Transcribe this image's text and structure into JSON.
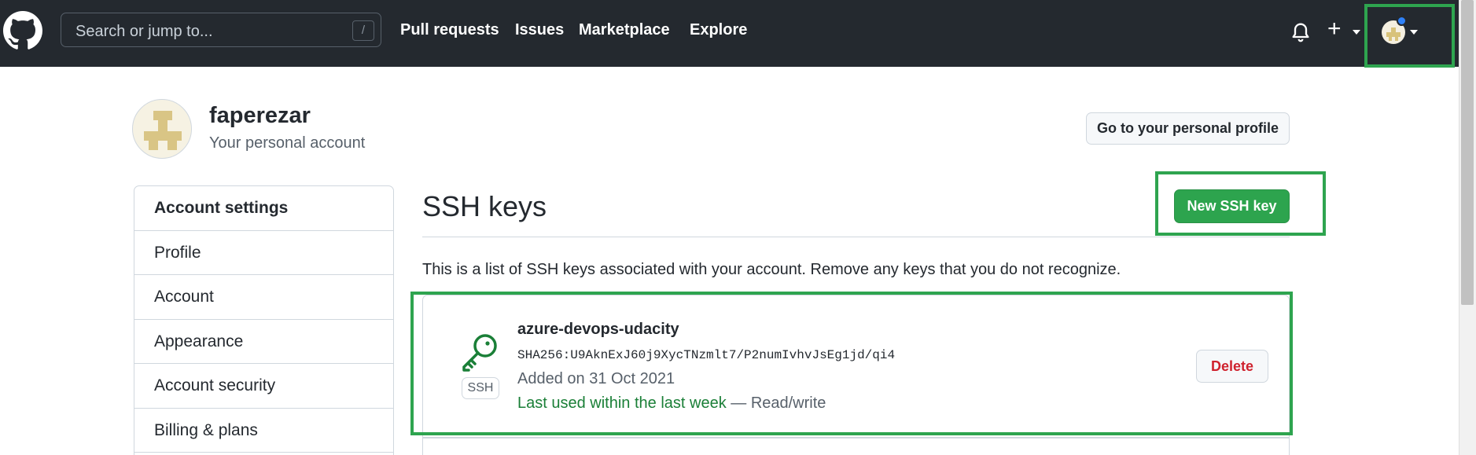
{
  "header": {
    "search_placeholder": "Search or jump to...",
    "search_shortcut": "/",
    "nav": [
      "Pull requests",
      "Issues",
      "Marketplace",
      "Explore"
    ],
    "plus_symbol": "+"
  },
  "profile": {
    "username": "faperezar",
    "subtitle": "Your personal account",
    "go_to_profile_label": "Go to your personal profile"
  },
  "sidebar": {
    "items": [
      {
        "label": "Account settings"
      },
      {
        "label": "Profile"
      },
      {
        "label": "Account"
      },
      {
        "label": "Appearance"
      },
      {
        "label": "Account security"
      },
      {
        "label": "Billing & plans"
      }
    ]
  },
  "main": {
    "title": "SSH keys",
    "new_key_label": "New SSH key",
    "description": "This is a list of SSH keys associated with your account. Remove any keys that you do not recognize.",
    "keys": [
      {
        "title": "azure-devops-udacity",
        "fingerprint": "SHA256:U9AknExJ60j9XycTNzmlt7/P2numIvhvJsEg1jd/qi4",
        "added": "Added on 31 Oct 2021",
        "last_used": "Last used within the last week",
        "access": " — Read/write",
        "type_badge": "SSH",
        "delete_label": "Delete"
      }
    ]
  },
  "colors": {
    "header_bg": "#24292f",
    "primary_green": "#2da44e",
    "highlight_green": "#2ea44f",
    "danger": "#cf222e",
    "notification": "#2f81f7"
  }
}
